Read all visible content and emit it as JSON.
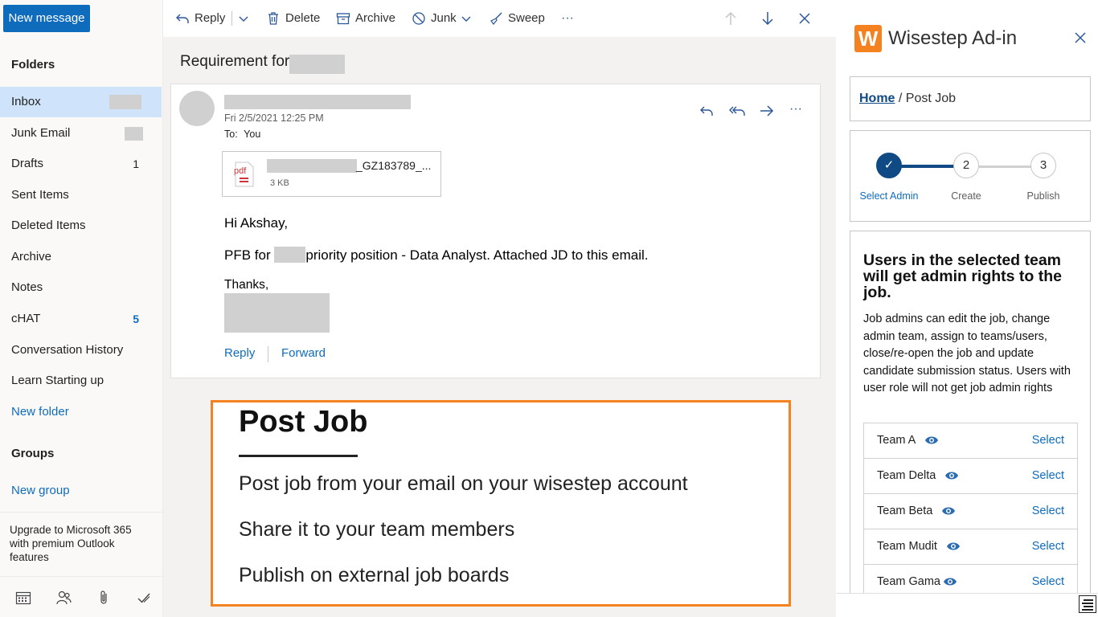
{
  "toolbar": {
    "new_message": "New message",
    "reply": "Reply",
    "delete": "Delete",
    "archive": "Archive",
    "junk": "Junk",
    "sweep": "Sweep",
    "more": "···"
  },
  "sidebar": {
    "folders_title": "Folders",
    "folders": [
      {
        "label": "Inbox",
        "count": ""
      },
      {
        "label": "Junk Email",
        "count": ""
      },
      {
        "label": "Drafts",
        "count": "1"
      },
      {
        "label": "Sent Items",
        "count": ""
      },
      {
        "label": "Deleted Items",
        "count": ""
      },
      {
        "label": "Archive",
        "count": ""
      },
      {
        "label": "Notes",
        "count": ""
      },
      {
        "label": "cHAT",
        "count": "5"
      },
      {
        "label": "Conversation History",
        "count": ""
      },
      {
        "label": "Learn Starting up",
        "count": ""
      }
    ],
    "new_folder": "New folder",
    "groups_title": "Groups",
    "new_group": "New group",
    "upgrade": "Upgrade to Microsoft 365 with premium Outlook features"
  },
  "email": {
    "subject": "Requirement for",
    "date": "Fri 2/5/2021 12:25 PM",
    "to_label": "To:",
    "to_value": "You",
    "attachment_name": "_GZ183789_...",
    "attachment_size": "3 KB",
    "attachment_type": "pdf",
    "greeting": "Hi Akshay,",
    "body_prefix": "PFB for",
    "body_suffix": "priority position - Data Analyst. Attached JD to this email.",
    "signoff": "Thanks,",
    "reply": "Reply",
    "forward": "Forward"
  },
  "promo": {
    "title": "Post Job",
    "lines": [
      "Post job from your email on your wisestep account",
      "Share it to your team members",
      "Publish on external job boards"
    ]
  },
  "addin": {
    "logo_letter": "W",
    "title": "Wisestep Ad-in",
    "breadcrumb_home": "Home",
    "breadcrumb_rest": " / Post Job",
    "steps": [
      {
        "label": "Select Admin",
        "marker": "✓",
        "state": "done"
      },
      {
        "label": "Create",
        "marker": "2",
        "state": "pending"
      },
      {
        "label": "Publish",
        "marker": "3",
        "state": "pending"
      }
    ],
    "heading": "Users in the selected team will get admin rights to the job.",
    "description": "Job admins can edit the job, change admin team, assign to teams/users, close/re-open the job and update candidate submission status. Users with user role will not get job admin rights",
    "select_label": "Select",
    "teams": [
      "Team A",
      "Team Delta",
      "Team Beta",
      "Team Mudit",
      "Team Gama"
    ]
  },
  "colors": {
    "accent": "#0f6cbd",
    "promo_border": "#f58220",
    "inbox_highlight": "#cfe4fa"
  }
}
